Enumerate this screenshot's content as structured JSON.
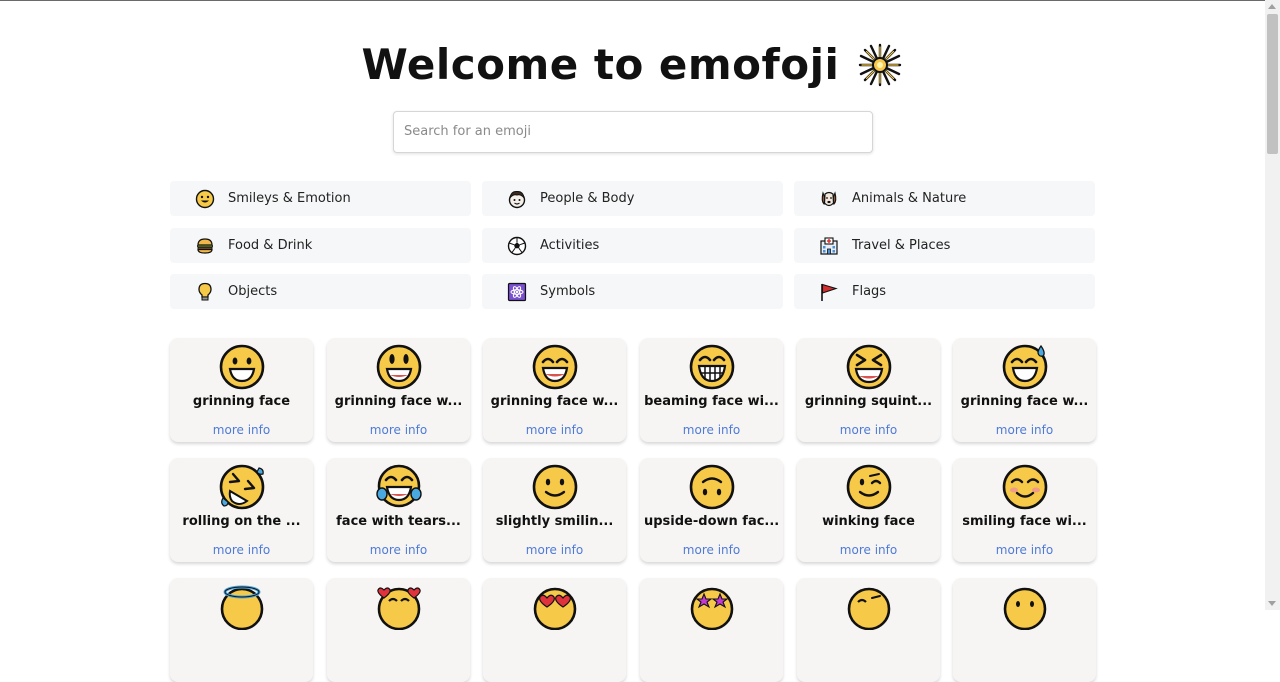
{
  "header": {
    "title": "Welcome to emofoji"
  },
  "search": {
    "placeholder": "Search for an emoji",
    "value": ""
  },
  "categories": [
    {
      "label": "Smileys & Emotion",
      "icon": "smiley-icon"
    },
    {
      "label": "People & Body",
      "icon": "person-icon"
    },
    {
      "label": "Animals & Nature",
      "icon": "dog-icon"
    },
    {
      "label": "Food & Drink",
      "icon": "burger-icon"
    },
    {
      "label": "Activities",
      "icon": "soccer-ball-icon"
    },
    {
      "label": "Travel & Places",
      "icon": "hospital-icon"
    },
    {
      "label": "Objects",
      "icon": "light-bulb-icon"
    },
    {
      "label": "Symbols",
      "icon": "atom-symbol-icon"
    },
    {
      "label": "Flags",
      "icon": "red-flag-icon"
    }
  ],
  "emojis": [
    {
      "name": "grinning face",
      "link": "more info",
      "icon": "grinning-face-icon"
    },
    {
      "name": "grinning face w...",
      "link": "more info",
      "icon": "grinning-face-big-eyes-icon"
    },
    {
      "name": "grinning face w...",
      "link": "more info",
      "icon": "grinning-face-smiling-eyes-icon"
    },
    {
      "name": "beaming face wi...",
      "link": "more info",
      "icon": "beaming-face-icon"
    },
    {
      "name": "grinning squint...",
      "link": "more info",
      "icon": "grinning-squinting-face-icon"
    },
    {
      "name": "grinning face w...",
      "link": "more info",
      "icon": "grinning-face-sweat-icon"
    },
    {
      "name": "rolling on the ...",
      "link": "more info",
      "icon": "rolling-laughing-face-icon"
    },
    {
      "name": "face with tears...",
      "link": "more info",
      "icon": "tears-of-joy-face-icon"
    },
    {
      "name": "slightly smilin...",
      "link": "more info",
      "icon": "slightly-smiling-face-icon"
    },
    {
      "name": "upside-down fac...",
      "link": "more info",
      "icon": "upside-down-face-icon"
    },
    {
      "name": "winking face",
      "link": "more info",
      "icon": "winking-face-icon"
    },
    {
      "name": "smiling face wi...",
      "link": "more info",
      "icon": "smiling-face-blush-icon"
    },
    {
      "name": "",
      "link": "",
      "icon": "halo-face-icon"
    },
    {
      "name": "",
      "link": "",
      "icon": "hearts-face-icon"
    },
    {
      "name": "",
      "link": "",
      "icon": "heart-eyes-face-icon"
    },
    {
      "name": "",
      "link": "",
      "icon": "star-struck-face-icon"
    },
    {
      "name": "",
      "link": "",
      "icon": "kissing-wink-face-icon"
    },
    {
      "name": "",
      "link": "",
      "icon": "kissing-face-icon"
    }
  ]
}
